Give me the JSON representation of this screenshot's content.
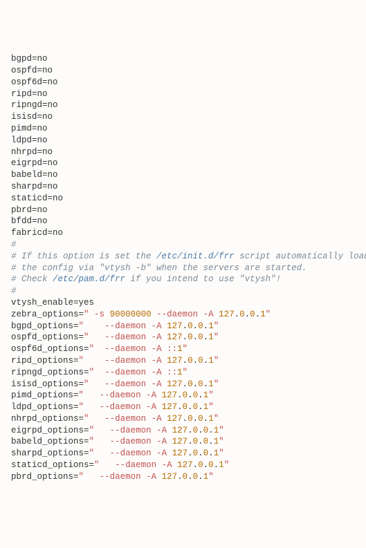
{
  "daemons": [
    {
      "name": "bgpd",
      "val": "no"
    },
    {
      "name": "ospfd",
      "val": "no"
    },
    {
      "name": "ospf6d",
      "val": "no"
    },
    {
      "name": "ripd",
      "val": "no"
    },
    {
      "name": "ripngd",
      "val": "no"
    },
    {
      "name": "isisd",
      "val": "no"
    },
    {
      "name": "pimd",
      "val": "no"
    },
    {
      "name": "ldpd",
      "val": "no"
    },
    {
      "name": "nhrpd",
      "val": "no"
    },
    {
      "name": "eigrpd",
      "val": "no"
    },
    {
      "name": "babeld",
      "val": "no"
    },
    {
      "name": "sharpd",
      "val": "no"
    },
    {
      "name": "staticd",
      "val": "no"
    },
    {
      "name": "pbrd",
      "val": "no"
    },
    {
      "name": "bfdd",
      "val": "no"
    },
    {
      "name": "fabricd",
      "val": "no"
    }
  ],
  "comments": {
    "l1": "#",
    "l2_a": "# If this option is set the ",
    "l2_b": "/etc/init.d/frr",
    "l2_c": " script automatically loads",
    "l3": "# the config via \"vtysh -b\" when the servers are started.",
    "l4_a": "# Check ",
    "l4_b": "/etc/pam.d/frr",
    "l4_c": " if you intend to use \"vtysh\"!",
    "l5": "#"
  },
  "vtysh": {
    "key": "vtysh_enable",
    "val": "yes"
  },
  "zebra": {
    "key": "zebra_options",
    "q": "\"",
    "a": " -s ",
    "size": "90000000",
    "b": " --daemon -A ",
    "ip_a": "127",
    "dot": ".",
    "ip_b": "0",
    "ip_c": "0",
    "ip_d": "1"
  },
  "opts": [
    {
      "key": "bgpd_options",
      "pad": "   ",
      "ip": "v4"
    },
    {
      "key": "ospfd_options",
      "pad": "  ",
      "ip": "v4"
    },
    {
      "key": "ospf6d_options",
      "pad": " ",
      "ip": "v6"
    },
    {
      "key": "ripd_options",
      "pad": "   ",
      "ip": "v4"
    },
    {
      "key": "ripngd_options",
      "pad": " ",
      "ip": "v6"
    },
    {
      "key": "isisd_options",
      "pad": "  ",
      "ip": "v4"
    },
    {
      "key": "pimd_options",
      "pad": "  ",
      "ip": "v4"
    },
    {
      "key": "ldpd_options",
      "pad": "  ",
      "ip": "v4"
    },
    {
      "key": "nhrpd_options",
      "pad": "  ",
      "ip": "v4"
    },
    {
      "key": "eigrpd_options",
      "pad": "  ",
      "ip": "v4"
    },
    {
      "key": "babeld_options",
      "pad": "  ",
      "ip": "v4"
    },
    {
      "key": "sharpd_options",
      "pad": "  ",
      "ip": "v4"
    },
    {
      "key": "staticd_options",
      "pad": "  ",
      "ip": "v4"
    },
    {
      "key": "pbrd_options",
      "pad": "  ",
      "ip": "v4"
    }
  ],
  "common": {
    "eq": "=",
    "q": "\"",
    "flag": " --daemon -A ",
    "v6": "::",
    "one": "1",
    "ip_a": "127",
    "ip_b": "0",
    "ip_c": "0",
    "ip_d": "1",
    "dot": "."
  }
}
